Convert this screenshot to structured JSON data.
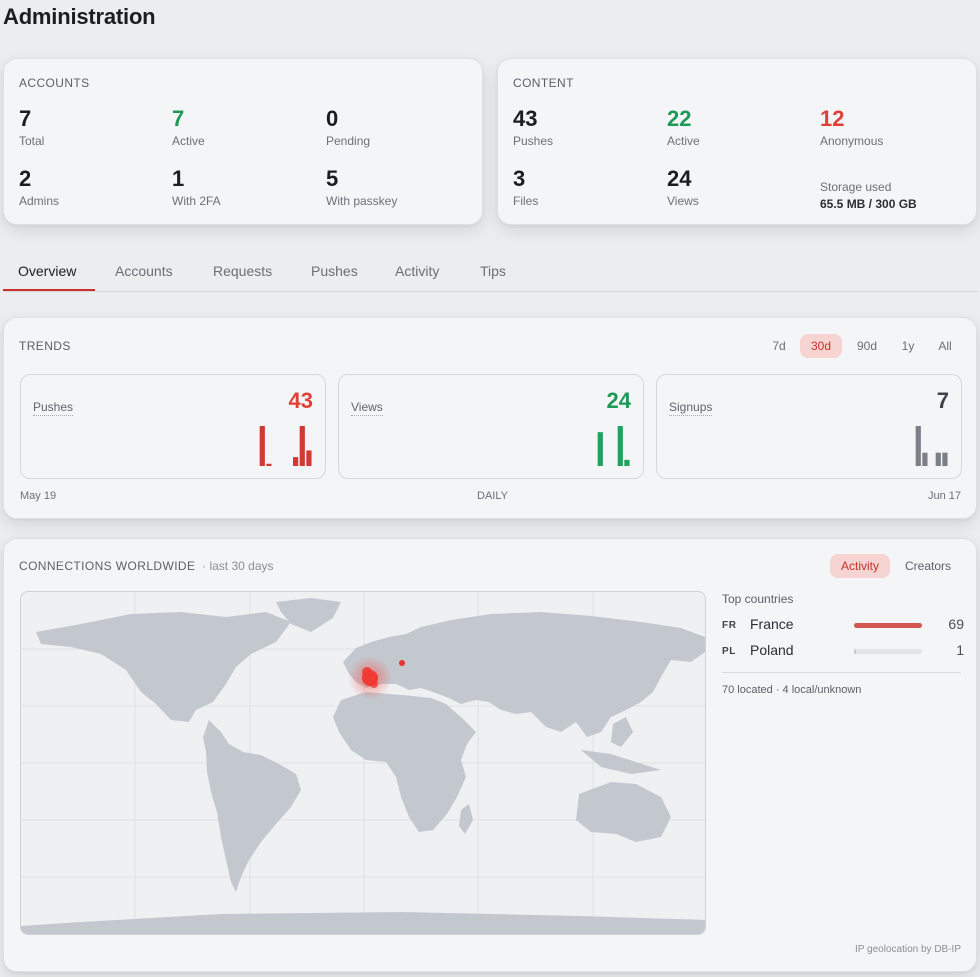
{
  "page": {
    "title": "Administration"
  },
  "accounts": {
    "label": "ACCOUNTS",
    "stats": [
      {
        "value": "7",
        "label": "Total"
      },
      {
        "value": "7",
        "label": "Active"
      },
      {
        "value": "0",
        "label": "Pending"
      },
      {
        "value": "2",
        "label": "Admins"
      },
      {
        "value": "1",
        "label": "With 2FA"
      },
      {
        "value": "5",
        "label": "With passkey"
      }
    ]
  },
  "content": {
    "label": "CONTENT",
    "stats": [
      {
        "value": "43",
        "label": "Pushes"
      },
      {
        "value": "22",
        "label": "Active"
      },
      {
        "value": "12",
        "label": "Anonymous"
      },
      {
        "value": "3",
        "label": "Files"
      },
      {
        "value": "24",
        "label": "Views"
      }
    ],
    "storage": {
      "label": "Storage used",
      "value": "65.5 MB / 300 GB"
    }
  },
  "tabs": [
    "Overview",
    "Accounts",
    "Requests",
    "Pushes",
    "Activity",
    "Tips"
  ],
  "trends": {
    "label": "TRENDS",
    "ranges": [
      "7d",
      "30d",
      "90d",
      "1y",
      "All"
    ],
    "selected_range": "30d",
    "x_start": "May 19",
    "x_mid": "DAILY",
    "x_end": "Jun 17",
    "colors": {
      "pushes": "#d03a33",
      "views": "#22a05e",
      "signups": "#7b8088"
    }
  },
  "chart_data": [
    {
      "type": "bar",
      "title": "Pushes",
      "total": "43",
      "values": [
        0,
        0,
        0,
        0,
        0,
        0,
        0,
        0,
        0,
        0,
        0,
        0,
        0,
        0,
        0,
        0,
        0,
        0,
        0,
        0,
        0,
        0,
        18,
        1,
        0,
        0,
        0,
        4,
        18,
        7
      ]
    },
    {
      "type": "bar",
      "title": "Views",
      "total": "24",
      "values": [
        0,
        0,
        0,
        0,
        0,
        0,
        0,
        0,
        0,
        0,
        0,
        0,
        0,
        0,
        0,
        0,
        0,
        0,
        0,
        0,
        0,
        0,
        0,
        0,
        0,
        11,
        0,
        0,
        13,
        2
      ]
    },
    {
      "type": "bar",
      "title": "Signups",
      "total": "7",
      "values": [
        0,
        0,
        0,
        0,
        0,
        0,
        0,
        0,
        0,
        0,
        0,
        0,
        0,
        0,
        0,
        0,
        0,
        0,
        0,
        0,
        0,
        0,
        0,
        0,
        0,
        3,
        1,
        0,
        1,
        1
      ]
    }
  ],
  "connections": {
    "title": "CONNECTIONS WORLDWIDE",
    "subtitle": "· last 30 days",
    "toggle": [
      "Activity",
      "Creators"
    ],
    "selected": "Activity",
    "top_countries_label": "Top countries",
    "countries": [
      {
        "code": "FR",
        "name": "France",
        "count": 69,
        "share": 1.0
      },
      {
        "code": "PL",
        "name": "Poland",
        "count": 1,
        "share": 0.015
      }
    ],
    "summary": "70 located · 4 local/unknown",
    "attribution": "IP geolocation by DB-IP"
  }
}
